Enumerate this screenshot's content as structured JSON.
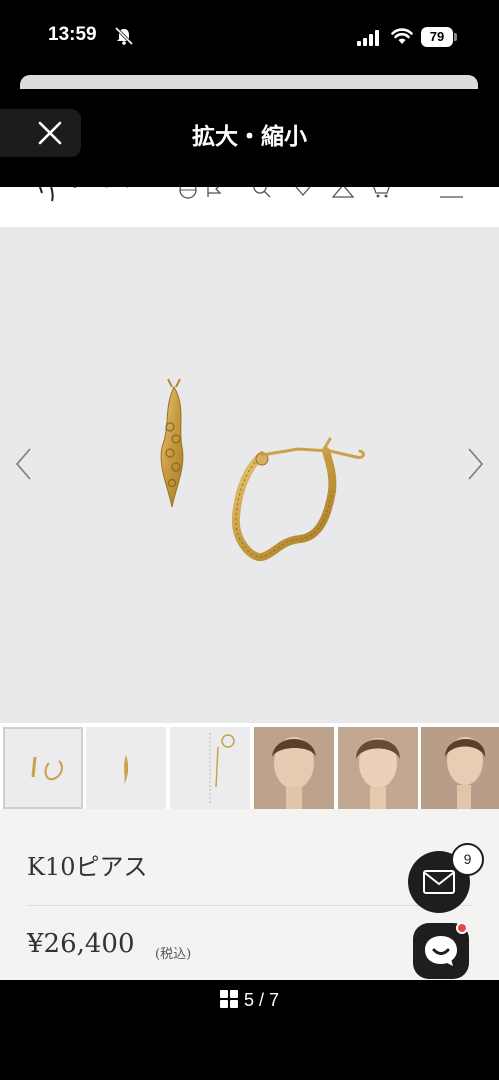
{
  "status_bar": {
    "time": "13:59",
    "battery": "79"
  },
  "modal": {
    "title": "拡大・縮小",
    "close_icon": "close-icon"
  },
  "product": {
    "title": "K10ピアス",
    "price": "¥26,400",
    "tax_note": "(税込)"
  },
  "thumbnails": [
    {
      "kind": "product",
      "active": true
    },
    {
      "kind": "product",
      "active": false
    },
    {
      "kind": "product",
      "active": false
    },
    {
      "kind": "model",
      "active": false
    },
    {
      "kind": "model",
      "active": false
    },
    {
      "kind": "model",
      "active": false
    }
  ],
  "floating": {
    "mail_badge": "9",
    "mail_icon": "mail-icon",
    "chat_icon": "chat-icon"
  },
  "pager": {
    "label": "5 / 7",
    "icon": "grid-icon"
  },
  "colors": {
    "modal_bg": "#000000",
    "hero_bg": "#e9e9eb",
    "info_bg": "#f4f3f1",
    "gold": "#c9a24a",
    "badge_red": "#e8454f"
  }
}
